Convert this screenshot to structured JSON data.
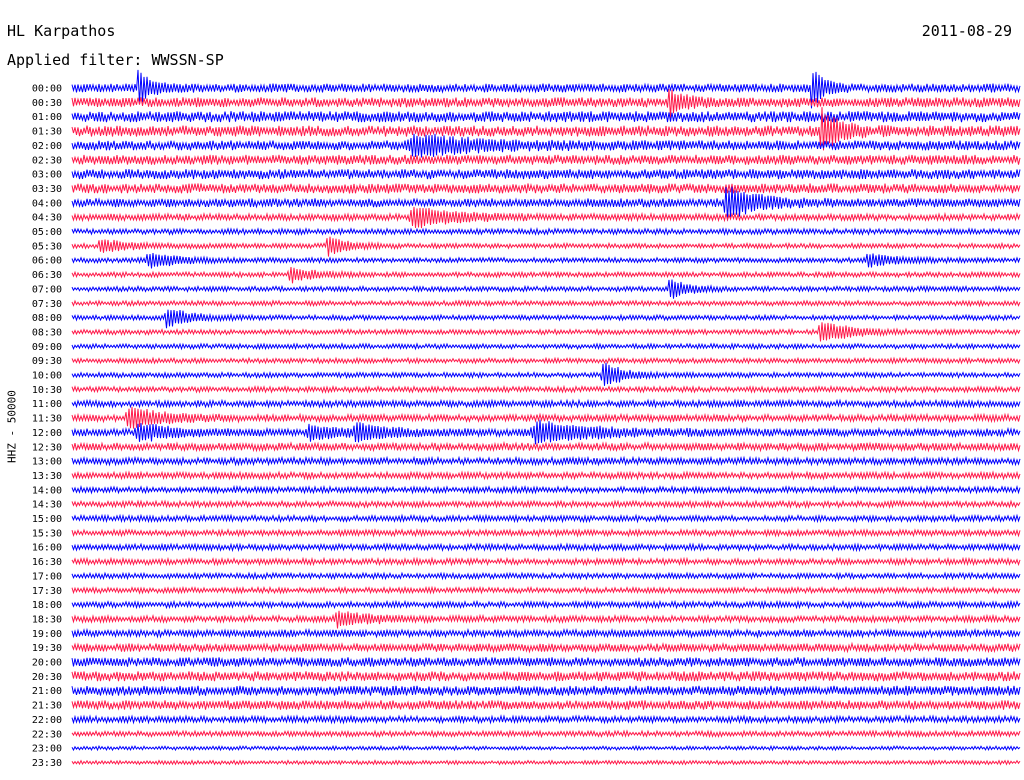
{
  "header": {
    "station": "HL Karpathos",
    "filter": "Applied filter: WWSSN-SP",
    "date": "2011-08-29"
  },
  "chart_data": {
    "type": "line",
    "title": "HL Karpathos",
    "subtitle": "Applied filter: WWSSN-SP",
    "date": "2011-08-29",
    "ylabel": "HHZ - 50000",
    "row_labels": [
      "00:00",
      "00:30",
      "01:00",
      "01:30",
      "02:00",
      "02:30",
      "03:00",
      "03:30",
      "04:00",
      "04:30",
      "05:00",
      "05:30",
      "06:00",
      "06:30",
      "07:00",
      "07:30",
      "08:00",
      "08:30",
      "09:00",
      "09:30",
      "10:00",
      "10:30",
      "11:00",
      "11:30",
      "12:00",
      "12:30",
      "13:00",
      "13:30",
      "14:00",
      "14:30",
      "15:00",
      "15:30",
      "16:00",
      "16:30",
      "17:00",
      "17:30",
      "18:00",
      "18:30",
      "19:00",
      "19:30",
      "20:00",
      "20:30",
      "21:00",
      "21:30",
      "22:00",
      "22:30",
      "23:00",
      "23:30"
    ],
    "trace_colors": [
      "#0000ff",
      "#ff1a4a"
    ],
    "noise_level": [
      0.8,
      0.9,
      1.0,
      1.0,
      0.9,
      0.9,
      0.9,
      0.9,
      0.8,
      0.6,
      0.5,
      0.45,
      0.45,
      0.45,
      0.45,
      0.45,
      0.45,
      0.45,
      0.45,
      0.45,
      0.45,
      0.5,
      0.6,
      0.65,
      0.7,
      0.7,
      0.65,
      0.6,
      0.55,
      0.55,
      0.55,
      0.55,
      0.55,
      0.55,
      0.5,
      0.5,
      0.55,
      0.6,
      0.65,
      0.75,
      0.85,
      0.9,
      0.9,
      0.85,
      0.6,
      0.5,
      0.35,
      0.35
    ],
    "events": [
      {
        "row": 0,
        "t": 0.07,
        "amp": 3.5,
        "w": 0.004
      },
      {
        "row": 0,
        "t": 0.78,
        "amp": 4.0,
        "w": 0.004
      },
      {
        "row": 1,
        "t": 0.63,
        "amp": 2.5,
        "w": 0.005
      },
      {
        "row": 3,
        "t": 0.79,
        "amp": 4.0,
        "w": 0.006
      },
      {
        "row": 4,
        "t": 0.36,
        "amp": 2.0,
        "w": 0.02
      },
      {
        "row": 8,
        "t": 0.69,
        "amp": 3.0,
        "w": 0.01
      },
      {
        "row": 9,
        "t": 0.36,
        "amp": 1.8,
        "w": 0.015
      },
      {
        "row": 11,
        "t": 0.03,
        "amp": 1.2,
        "w": 0.01
      },
      {
        "row": 11,
        "t": 0.27,
        "amp": 2.0,
        "w": 0.006
      },
      {
        "row": 12,
        "t": 0.08,
        "amp": 1.4,
        "w": 0.01
      },
      {
        "row": 12,
        "t": 0.84,
        "amp": 1.2,
        "w": 0.01
      },
      {
        "row": 13,
        "t": 0.23,
        "amp": 1.3,
        "w": 0.008
      },
      {
        "row": 14,
        "t": 0.63,
        "amp": 2.0,
        "w": 0.006
      },
      {
        "row": 16,
        "t": 0.1,
        "amp": 1.8,
        "w": 0.008
      },
      {
        "row": 17,
        "t": 0.79,
        "amp": 2.0,
        "w": 0.01
      },
      {
        "row": 20,
        "t": 0.56,
        "amp": 2.5,
        "w": 0.006
      },
      {
        "row": 23,
        "t": 0.06,
        "amp": 1.8,
        "w": 0.012
      },
      {
        "row": 24,
        "t": 0.07,
        "amp": 1.5,
        "w": 0.012
      },
      {
        "row": 24,
        "t": 0.25,
        "amp": 1.2,
        "w": 0.012
      },
      {
        "row": 24,
        "t": 0.3,
        "amp": 1.4,
        "w": 0.01
      },
      {
        "row": 24,
        "t": 0.49,
        "amp": 1.8,
        "w": 0.02
      },
      {
        "row": 37,
        "t": 0.28,
        "amp": 1.4,
        "w": 0.01
      }
    ]
  }
}
